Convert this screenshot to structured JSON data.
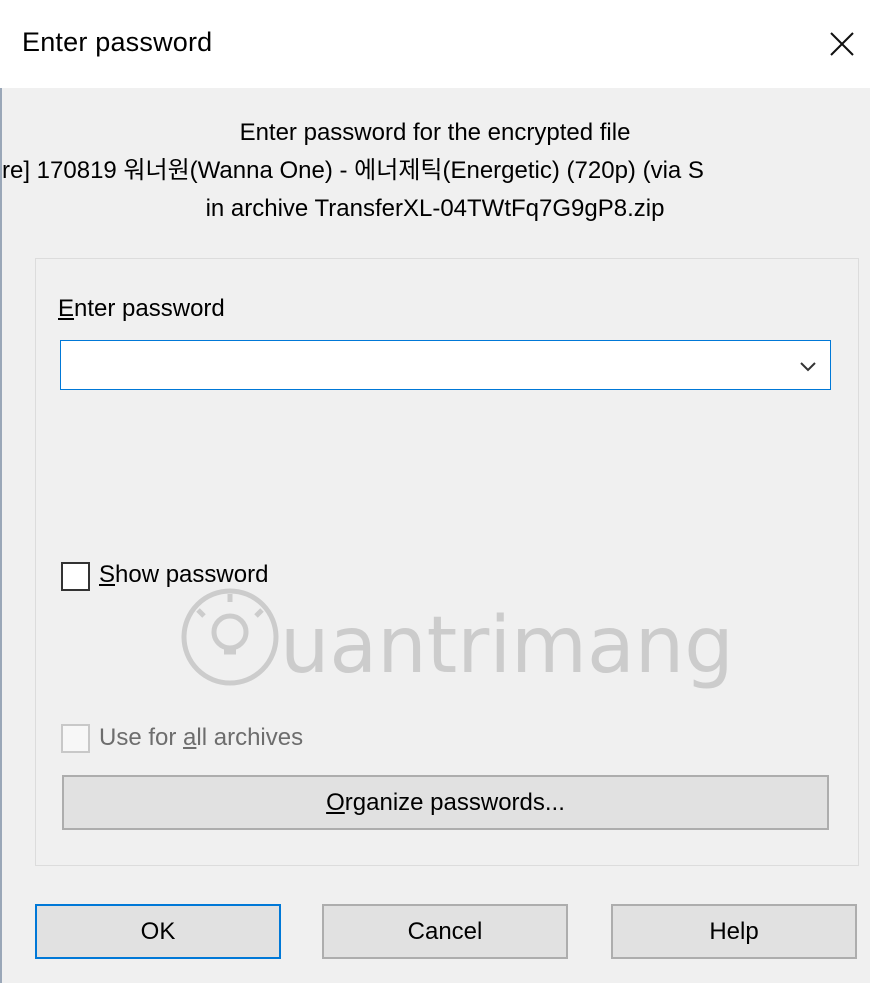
{
  "window": {
    "title": "Enter password",
    "close_icon": "close-icon"
  },
  "info": {
    "line1": "Enter password for the encrypted file",
    "line2": "re] 170819 워너원(Wanna One) - 에너제틱(Energetic) (720p) (via S",
    "line3": "in archive TransferXL-04TWtFq7G9gP8.zip"
  },
  "password": {
    "label_mnemonic": "E",
    "label_rest": "nter password",
    "value": "",
    "dropdown_icon": "chevron-down-icon"
  },
  "show_password": {
    "mnemonic": "S",
    "rest": "how password",
    "checked": false
  },
  "use_for_all": {
    "pre": "Use for ",
    "mnemonic": "a",
    "post": "ll archives",
    "checked": false,
    "disabled": true
  },
  "organize": {
    "mnemonic": "O",
    "rest": "rganize passwords..."
  },
  "buttons": {
    "ok": "OK",
    "cancel": "Cancel",
    "help": "Help"
  },
  "watermark": {
    "text": "uantrimang",
    "icon": "lightbulb-icon"
  },
  "colors": {
    "accent": "#0078d7",
    "button_face": "#e1e1e1",
    "dialog_bg": "#f0f0f0"
  }
}
